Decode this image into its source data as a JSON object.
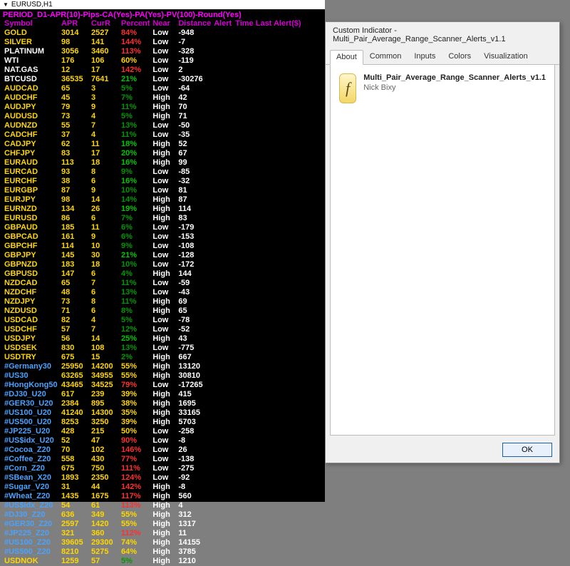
{
  "chart": {
    "titlebar": "EURUSD,H1",
    "indicator_title": "PERIOD_D1-APR(10)-Pips-CA(Yes)-PA(Yes)-PV(100)-Round(Yes)",
    "headers": [
      "Symbol",
      "APR",
      "CurR",
      "Percent",
      "Near",
      "Distance",
      "Alert",
      "Time Last Alert($)"
    ]
  },
  "rows": [
    {
      "sym": "GOLD",
      "symCls": "sym-gold",
      "apr": "3014",
      "cur": "2527",
      "pct": "84%",
      "pctCls": "pct-red",
      "near": "Low",
      "dist": "-948"
    },
    {
      "sym": "SILVER",
      "symCls": "sym-gold",
      "apr": "98",
      "cur": "141",
      "pct": "144%",
      "pctCls": "pct-red",
      "near": "Low",
      "dist": "-7"
    },
    {
      "sym": "PLATINUM",
      "symCls": "sym-white",
      "apr": "3056",
      "cur": "3460",
      "pct": "113%",
      "pctCls": "pct-red",
      "near": "Low",
      "dist": "-328"
    },
    {
      "sym": "WTI",
      "symCls": "sym-white",
      "apr": "176",
      "cur": "106",
      "pct": "60%",
      "pctCls": "pct-yellow",
      "near": "Low",
      "dist": "-119"
    },
    {
      "sym": "NAT.GAS",
      "symCls": "sym-white",
      "apr": "12",
      "cur": "17",
      "pct": "142%",
      "pctCls": "pct-red",
      "near": "Low",
      "dist": "2"
    },
    {
      "sym": "BTCUSD",
      "symCls": "sym-white",
      "apr": "36535",
      "cur": "7641",
      "pct": "21%",
      "pctCls": "pct-green",
      "near": "Low",
      "dist": "-30276"
    },
    {
      "sym": "AUDCAD",
      "symCls": "sym-gold",
      "apr": "65",
      "cur": "3",
      "pct": "5%",
      "pctCls": "pct-dgreen",
      "near": "Low",
      "dist": "-64"
    },
    {
      "sym": "AUDCHF",
      "symCls": "sym-gold",
      "apr": "45",
      "cur": "3",
      "pct": "7%",
      "pctCls": "pct-dgreen",
      "near": "High",
      "dist": "42"
    },
    {
      "sym": "AUDJPY",
      "symCls": "sym-gold",
      "apr": "79",
      "cur": "9",
      "pct": "11%",
      "pctCls": "pct-dgreen",
      "near": "High",
      "dist": "70"
    },
    {
      "sym": "AUDUSD",
      "symCls": "sym-gold",
      "apr": "73",
      "cur": "4",
      "pct": "5%",
      "pctCls": "pct-dgreen",
      "near": "High",
      "dist": "71"
    },
    {
      "sym": "AUDNZD",
      "symCls": "sym-gold",
      "apr": "55",
      "cur": "7",
      "pct": "13%",
      "pctCls": "pct-dgreen",
      "near": "Low",
      "dist": "-50"
    },
    {
      "sym": "CADCHF",
      "symCls": "sym-gold",
      "apr": "37",
      "cur": "4",
      "pct": "11%",
      "pctCls": "pct-dgreen",
      "near": "Low",
      "dist": "-35"
    },
    {
      "sym": "CADJPY",
      "symCls": "sym-gold",
      "apr": "62",
      "cur": "11",
      "pct": "18%",
      "pctCls": "pct-green",
      "near": "High",
      "dist": "52"
    },
    {
      "sym": "CHFJPY",
      "symCls": "sym-gold",
      "apr": "83",
      "cur": "17",
      "pct": "20%",
      "pctCls": "pct-green",
      "near": "High",
      "dist": "67"
    },
    {
      "sym": "EURAUD",
      "symCls": "sym-gold",
      "apr": "113",
      "cur": "18",
      "pct": "16%",
      "pctCls": "pct-green",
      "near": "High",
      "dist": "99"
    },
    {
      "sym": "EURCAD",
      "symCls": "sym-gold",
      "apr": "93",
      "cur": "8",
      "pct": "9%",
      "pctCls": "pct-dgreen",
      "near": "Low",
      "dist": "-85"
    },
    {
      "sym": "EURCHF",
      "symCls": "sym-gold",
      "apr": "38",
      "cur": "6",
      "pct": "16%",
      "pctCls": "pct-green",
      "near": "Low",
      "dist": "-32"
    },
    {
      "sym": "EURGBP",
      "symCls": "sym-gold",
      "apr": "87",
      "cur": "9",
      "pct": "10%",
      "pctCls": "pct-dgreen",
      "near": "Low",
      "dist": "81"
    },
    {
      "sym": "EURJPY",
      "symCls": "sym-gold",
      "apr": "98",
      "cur": "14",
      "pct": "14%",
      "pctCls": "pct-dgreen",
      "near": "High",
      "dist": "87"
    },
    {
      "sym": "EURNZD",
      "symCls": "sym-gold",
      "apr": "134",
      "cur": "26",
      "pct": "19%",
      "pctCls": "pct-green",
      "near": "High",
      "dist": "114"
    },
    {
      "sym": "EURUSD",
      "symCls": "sym-gold",
      "apr": "86",
      "cur": "6",
      "pct": "7%",
      "pctCls": "pct-dgreen",
      "near": "High",
      "dist": "83"
    },
    {
      "sym": "GBPAUD",
      "symCls": "sym-gold",
      "apr": "185",
      "cur": "11",
      "pct": "6%",
      "pctCls": "pct-dgreen",
      "near": "Low",
      "dist": "-179"
    },
    {
      "sym": "GBPCAD",
      "symCls": "sym-gold",
      "apr": "161",
      "cur": "9",
      "pct": "6%",
      "pctCls": "pct-dgreen",
      "near": "Low",
      "dist": "-153"
    },
    {
      "sym": "GBPCHF",
      "symCls": "sym-gold",
      "apr": "114",
      "cur": "10",
      "pct": "9%",
      "pctCls": "pct-dgreen",
      "near": "Low",
      "dist": "-108"
    },
    {
      "sym": "GBPJPY",
      "symCls": "sym-gold",
      "apr": "145",
      "cur": "30",
      "pct": "21%",
      "pctCls": "pct-green",
      "near": "Low",
      "dist": "-128"
    },
    {
      "sym": "GBPNZD",
      "symCls": "sym-gold",
      "apr": "183",
      "cur": "18",
      "pct": "10%",
      "pctCls": "pct-dgreen",
      "near": "Low",
      "dist": "-172"
    },
    {
      "sym": "GBPUSD",
      "symCls": "sym-gold",
      "apr": "147",
      "cur": "6",
      "pct": "4%",
      "pctCls": "pct-dgreen",
      "near": "High",
      "dist": "144"
    },
    {
      "sym": "NZDCAD",
      "symCls": "sym-gold",
      "apr": "65",
      "cur": "7",
      "pct": "11%",
      "pctCls": "pct-dgreen",
      "near": "Low",
      "dist": "-59"
    },
    {
      "sym": "NZDCHF",
      "symCls": "sym-gold",
      "apr": "48",
      "cur": "6",
      "pct": "13%",
      "pctCls": "pct-dgreen",
      "near": "Low",
      "dist": "-43"
    },
    {
      "sym": "NZDJPY",
      "symCls": "sym-gold",
      "apr": "73",
      "cur": "8",
      "pct": "11%",
      "pctCls": "pct-dgreen",
      "near": "High",
      "dist": "69"
    },
    {
      "sym": "NZDUSD",
      "symCls": "sym-gold",
      "apr": "71",
      "cur": "6",
      "pct": "8%",
      "pctCls": "pct-dgreen",
      "near": "High",
      "dist": "65"
    },
    {
      "sym": "USDCAD",
      "symCls": "sym-gold",
      "apr": "82",
      "cur": "4",
      "pct": "5%",
      "pctCls": "pct-dgreen",
      "near": "Low",
      "dist": "-78"
    },
    {
      "sym": "USDCHF",
      "symCls": "sym-gold",
      "apr": "57",
      "cur": "7",
      "pct": "12%",
      "pctCls": "pct-dgreen",
      "near": "Low",
      "dist": "-52"
    },
    {
      "sym": "USDJPY",
      "symCls": "sym-gold",
      "apr": "56",
      "cur": "14",
      "pct": "25%",
      "pctCls": "pct-green",
      "near": "High",
      "dist": "43"
    },
    {
      "sym": "USDSEK",
      "symCls": "sym-gold",
      "apr": "830",
      "cur": "108",
      "pct": "13%",
      "pctCls": "pct-dgreen",
      "near": "Low",
      "dist": "-775"
    },
    {
      "sym": "USDTRY",
      "symCls": "sym-gold",
      "apr": "675",
      "cur": "15",
      "pct": "2%",
      "pctCls": "pct-dgreen",
      "near": "High",
      "dist": "667"
    },
    {
      "sym": "#Germany30",
      "symCls": "sym-blue",
      "apr": "25950",
      "cur": "14200",
      "pct": "55%",
      "pctCls": "pct-yellow",
      "near": "High",
      "dist": "13120"
    },
    {
      "sym": "#US30",
      "symCls": "sym-blue",
      "apr": "63265",
      "cur": "34955",
      "pct": "55%",
      "pctCls": "pct-yellow",
      "near": "High",
      "dist": "30810"
    },
    {
      "sym": "#HongKong50",
      "symCls": "sym-blue",
      "apr": "43465",
      "cur": "34525",
      "pct": "79%",
      "pctCls": "pct-red",
      "near": "Low",
      "dist": "-17265"
    },
    {
      "sym": "#DJ30_U20",
      "symCls": "sym-blue",
      "apr": "617",
      "cur": "239",
      "pct": "39%",
      "pctCls": "pct-yellow",
      "near": "High",
      "dist": "415"
    },
    {
      "sym": "#GER30_U20",
      "symCls": "sym-blue",
      "apr": "2384",
      "cur": "895",
      "pct": "38%",
      "pctCls": "pct-yellow",
      "near": "High",
      "dist": "1695"
    },
    {
      "sym": "#US100_U20",
      "symCls": "sym-blue",
      "apr": "41240",
      "cur": "14300",
      "pct": "35%",
      "pctCls": "pct-yellow",
      "near": "High",
      "dist": "33165"
    },
    {
      "sym": "#US500_U20",
      "symCls": "sym-blue",
      "apr": "8253",
      "cur": "3250",
      "pct": "39%",
      "pctCls": "pct-yellow",
      "near": "High",
      "dist": "5703"
    },
    {
      "sym": "#JP225_U20",
      "symCls": "sym-blue",
      "apr": "428",
      "cur": "215",
      "pct": "50%",
      "pctCls": "pct-yellow",
      "near": "Low",
      "dist": "-258"
    },
    {
      "sym": "#US$idx_U20",
      "symCls": "sym-blue",
      "apr": "52",
      "cur": "47",
      "pct": "90%",
      "pctCls": "pct-red",
      "near": "Low",
      "dist": "-8"
    },
    {
      "sym": "#Cocoa_Z20",
      "symCls": "sym-blue",
      "apr": "70",
      "cur": "102",
      "pct": "146%",
      "pctCls": "pct-red",
      "near": "Low",
      "dist": "26"
    },
    {
      "sym": "#Coffee_Z20",
      "symCls": "sym-blue",
      "apr": "558",
      "cur": "430",
      "pct": "77%",
      "pctCls": "pct-red",
      "near": "Low",
      "dist": "-138"
    },
    {
      "sym": "#Corn_Z20",
      "symCls": "sym-blue",
      "apr": "675",
      "cur": "750",
      "pct": "111%",
      "pctCls": "pct-red",
      "near": "Low",
      "dist": "-275"
    },
    {
      "sym": "#SBean_X20",
      "symCls": "sym-blue",
      "apr": "1893",
      "cur": "2350",
      "pct": "124%",
      "pctCls": "pct-red",
      "near": "Low",
      "dist": "-92"
    },
    {
      "sym": "#Sugar_V20",
      "symCls": "sym-blue",
      "apr": "31",
      "cur": "44",
      "pct": "142%",
      "pctCls": "pct-red",
      "near": "High",
      "dist": "-8"
    },
    {
      "sym": "#Wheat_Z20",
      "symCls": "sym-blue",
      "apr": "1435",
      "cur": "1675",
      "pct": "117%",
      "pctCls": "pct-red",
      "near": "High",
      "dist": "560"
    },
    {
      "sym": "#US$idx_Z20",
      "symCls": "sym-blue",
      "apr": "54",
      "cur": "61",
      "pct": "113%",
      "pctCls": "pct-red",
      "near": "High",
      "dist": "4"
    },
    {
      "sym": "#DJ30_Z20",
      "symCls": "sym-blue",
      "apr": "636",
      "cur": "349",
      "pct": "55%",
      "pctCls": "pct-yellow",
      "near": "High",
      "dist": "312"
    },
    {
      "sym": "#GER30_Z20",
      "symCls": "sym-blue",
      "apr": "2597",
      "cur": "1420",
      "pct": "55%",
      "pctCls": "pct-yellow",
      "near": "High",
      "dist": "1317"
    },
    {
      "sym": "#JP225_Z20",
      "symCls": "sym-blue",
      "apr": "321",
      "cur": "360",
      "pct": "112%",
      "pctCls": "pct-red",
      "near": "High",
      "dist": "11"
    },
    {
      "sym": "#US100_Z20",
      "symCls": "sym-blue",
      "apr": "39605",
      "cur": "29300",
      "pct": "74%",
      "pctCls": "pct-yellow",
      "near": "High",
      "dist": "14155"
    },
    {
      "sym": "#US500_Z20",
      "symCls": "sym-blue",
      "apr": "8210",
      "cur": "5275",
      "pct": "64%",
      "pctCls": "pct-yellow",
      "near": "High",
      "dist": "3785"
    },
    {
      "sym": "USDNOK",
      "symCls": "sym-gold",
      "apr": "1259",
      "cur": "57",
      "pct": "5%",
      "pctCls": "pct-dgreen",
      "near": "High",
      "dist": "1210"
    }
  ],
  "dialog": {
    "title": "Custom Indicator - Multi_Pair_Average_Range_Scanner_Alerts_v1.1",
    "tabs": [
      "About",
      "Common",
      "Inputs",
      "Colors",
      "Visualization"
    ],
    "active_tab": 0,
    "about": {
      "name": "Multi_Pair_Average_Range_Scanner_Alerts_v1.1",
      "author": "Nick Bixy"
    },
    "ok_label": "OK"
  }
}
